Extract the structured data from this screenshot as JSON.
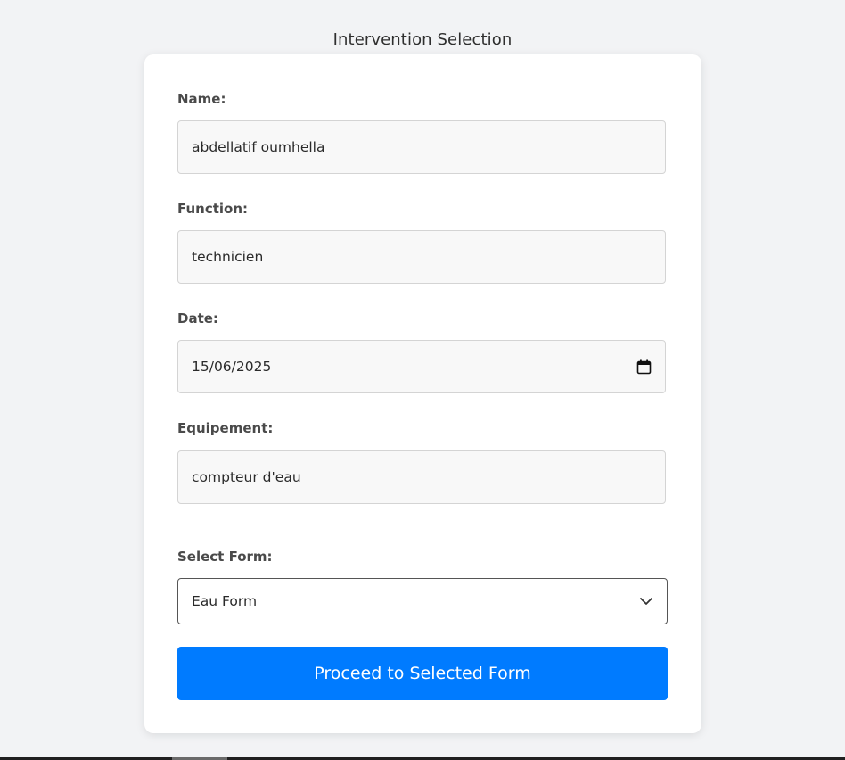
{
  "page": {
    "title": "Intervention Selection"
  },
  "form": {
    "name": {
      "label": "Name:",
      "value": "abdellatif oumhella"
    },
    "function": {
      "label": "Function:",
      "value": "technicien"
    },
    "date": {
      "label": "Date:",
      "value": "15/06/2025",
      "icon": "calendar-icon"
    },
    "equipement": {
      "label": "Equipement:",
      "value": "compteur d'eau"
    },
    "select_form": {
      "label": "Select Form:",
      "selected": "Eau Form",
      "icon": "chevron-down-icon"
    },
    "submit_label": "Proceed to Selected Form"
  },
  "colors": {
    "background": "#f2f3f5",
    "card": "#ffffff",
    "field_background": "#f8f8f8",
    "primary_button": "#007bff",
    "button_text": "#ffffff"
  }
}
